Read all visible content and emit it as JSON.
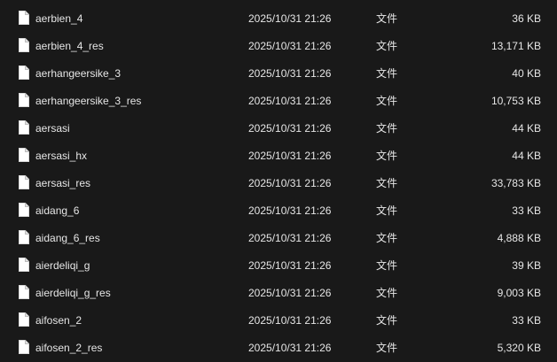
{
  "files": [
    {
      "name": "aerbien_4",
      "date": "2025/10/31 21:26",
      "type": "文件",
      "size": "36 KB",
      "icon": "file-icon"
    },
    {
      "name": "aerbien_4_res",
      "date": "2025/10/31 21:26",
      "type": "文件",
      "size": "13,171 KB",
      "icon": "file-icon"
    },
    {
      "name": "aerhangeersike_3",
      "date": "2025/10/31 21:26",
      "type": "文件",
      "size": "40 KB",
      "icon": "file-icon"
    },
    {
      "name": "aerhangeersike_3_res",
      "date": "2025/10/31 21:26",
      "type": "文件",
      "size": "10,753 KB",
      "icon": "file-icon"
    },
    {
      "name": "aersasi",
      "date": "2025/10/31 21:26",
      "type": "文件",
      "size": "44 KB",
      "icon": "file-icon"
    },
    {
      "name": "aersasi_hx",
      "date": "2025/10/31 21:26",
      "type": "文件",
      "size": "44 KB",
      "icon": "file-icon"
    },
    {
      "name": "aersasi_res",
      "date": "2025/10/31 21:26",
      "type": "文件",
      "size": "33,783 KB",
      "icon": "file-icon"
    },
    {
      "name": "aidang_6",
      "date": "2025/10/31 21:26",
      "type": "文件",
      "size": "33 KB",
      "icon": "file-icon"
    },
    {
      "name": "aidang_6_res",
      "date": "2025/10/31 21:26",
      "type": "文件",
      "size": "4,888 KB",
      "icon": "file-icon"
    },
    {
      "name": "aierdeliqi_g",
      "date": "2025/10/31 21:26",
      "type": "文件",
      "size": "39 KB",
      "icon": "file-icon"
    },
    {
      "name": "aierdeliqi_g_res",
      "date": "2025/10/31 21:26",
      "type": "文件",
      "size": "9,003 KB",
      "icon": "file-icon"
    },
    {
      "name": "aifosen_2",
      "date": "2025/10/31 21:26",
      "type": "文件",
      "size": "33 KB",
      "icon": "file-icon"
    },
    {
      "name": "aifosen_2_res",
      "date": "2025/10/31 21:26",
      "type": "文件",
      "size": "5,320 KB",
      "icon": "file-icon"
    }
  ],
  "colors": {
    "background": "#191919",
    "text": "#e6e6e6",
    "icon_fill": "#ffffff"
  }
}
